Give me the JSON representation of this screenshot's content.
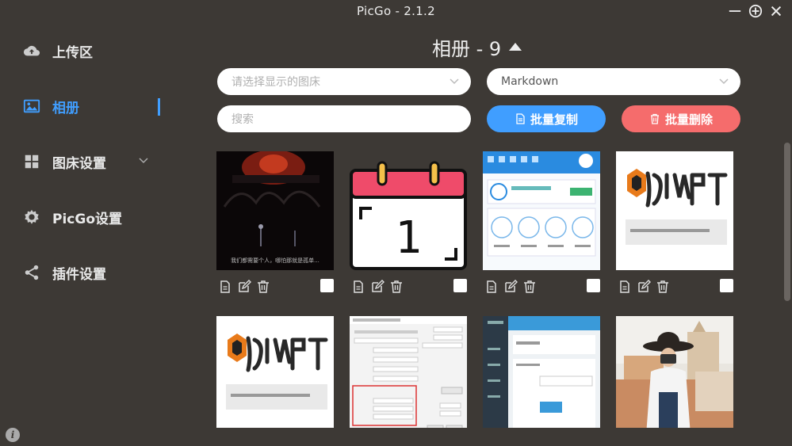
{
  "app": {
    "title": "PicGo - 2.1.2"
  },
  "sidebar": {
    "items": [
      {
        "label": "上传区",
        "icon": "cloud-upload-icon"
      },
      {
        "label": "相册",
        "icon": "image-icon",
        "active": true
      },
      {
        "label": "图床设置",
        "icon": "grid-icon",
        "has_submenu": true
      },
      {
        "label": "PicGo设置",
        "icon": "gear-icon"
      },
      {
        "label": "插件设置",
        "icon": "share-icon"
      }
    ]
  },
  "gallery": {
    "title": "相册 - 9",
    "bed_select": {
      "placeholder": "请选择显示的图床",
      "value": ""
    },
    "format_select": {
      "value": "Markdown"
    },
    "search": {
      "placeholder": "搜索",
      "value": ""
    },
    "copy_button": "批量复制",
    "delete_button": "批量删除",
    "colors": {
      "accent": "#409eff",
      "danger": "#f56c6c",
      "background": "#3d3935"
    },
    "items": [
      {
        "thumb": "dark-stage-photo",
        "caption": "我们都需要个人，哪怕那就是孤单..."
      },
      {
        "thumb": "calendar-icon-image",
        "caption": "1"
      },
      {
        "thumb": "app-screenshot-blue"
      },
      {
        "thumb": "dumpt-logo-banner"
      },
      {
        "thumb": "dumpt-logo-banner"
      },
      {
        "thumb": "settings-dialog-screenshot"
      },
      {
        "thumb": "admin-panel-screenshot"
      },
      {
        "thumb": "woman-with-camera-photo"
      }
    ]
  }
}
